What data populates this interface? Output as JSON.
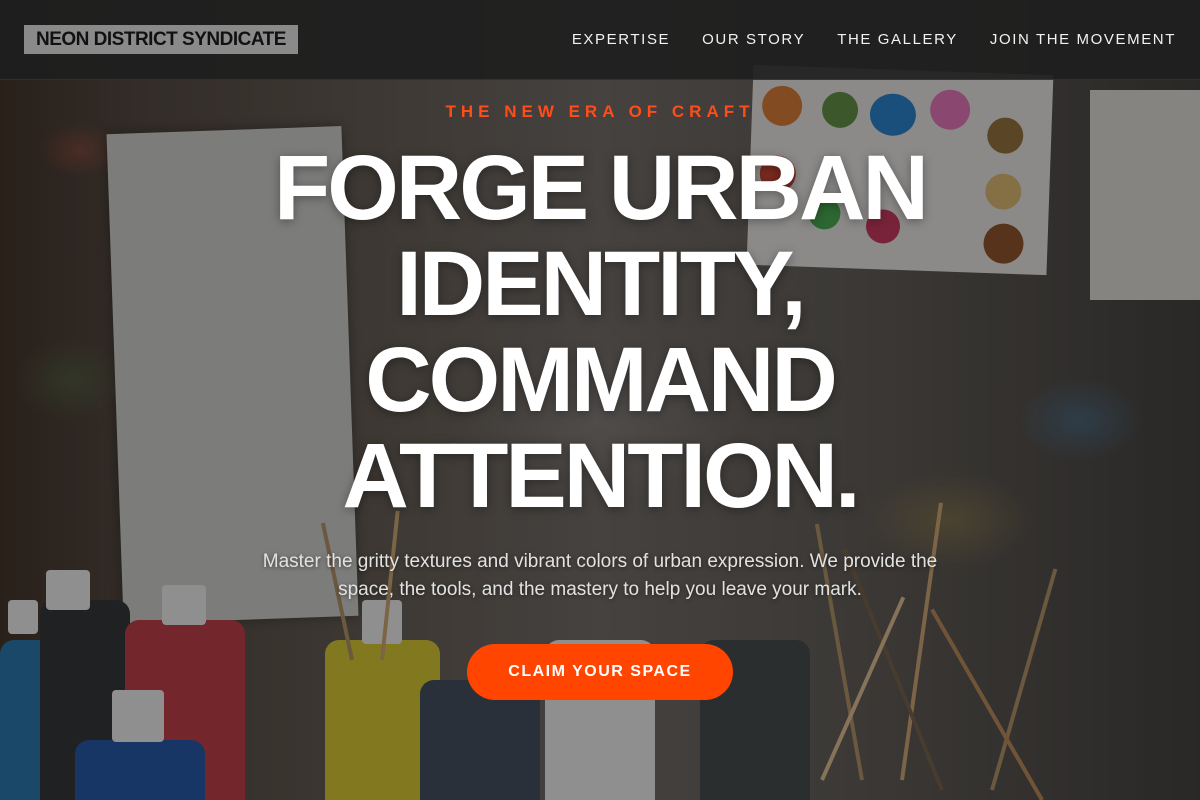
{
  "brand": {
    "name": "NEON DISTRICT SYNDICATE"
  },
  "nav": {
    "items": [
      {
        "label": "EXPERTISE"
      },
      {
        "label": "OUR STORY"
      },
      {
        "label": "THE GALLERY"
      },
      {
        "label": "JOIN THE MOVEMENT"
      }
    ]
  },
  "hero": {
    "eyebrow": "THE NEW ERA OF CRAFT",
    "headline": "FORGE URBAN IDENTITY, COMMAND ATTENTION.",
    "subtext": "Master the gritty textures and vibrant colors of urban expression. We provide the space, the tools, and the mastery to help you leave your mark.",
    "cta_label": "CLAIM YOUR SPACE",
    "background_image": "painter-studio-photo"
  },
  "colors": {
    "accent": "#ff4500",
    "header_bg": "#1e1e1e",
    "logo_bg": "#8a8a8a",
    "text": "#ffffff"
  }
}
